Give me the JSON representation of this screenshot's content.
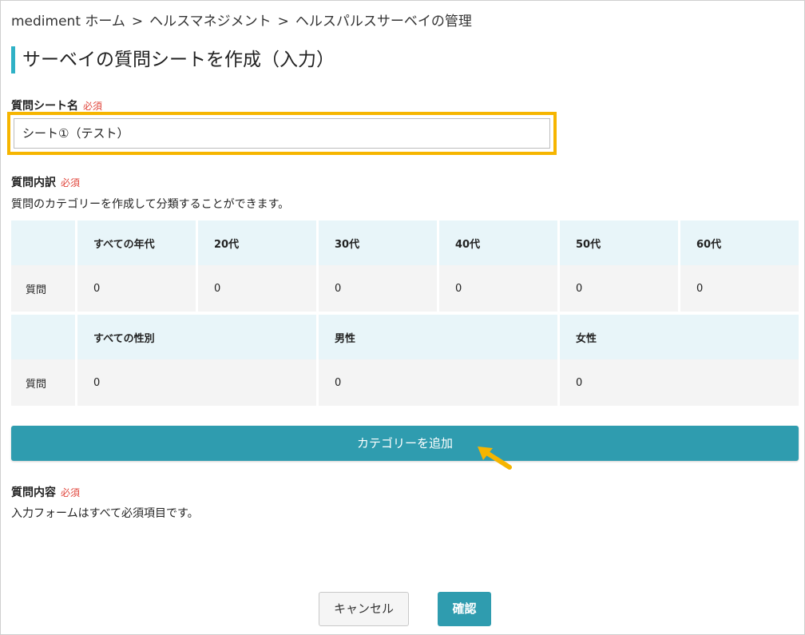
{
  "breadcrumb": {
    "items": [
      "mediment ホーム",
      "ヘルスマネジメント",
      "ヘルスパルスサーベイの管理"
    ],
    "separator": ">"
  },
  "page": {
    "title": "サーベイの質問シートを作成（入力）"
  },
  "sheet_name": {
    "label": "質問シート名",
    "required": "必須",
    "value": "シート①（テスト）"
  },
  "breakdown": {
    "label": "質問内訳",
    "required": "必須",
    "helper": "質問のカテゴリーを作成して分類することができます。",
    "age": {
      "headers": [
        "すべての年代",
        "20代",
        "30代",
        "40代",
        "50代",
        "60代"
      ],
      "row_label": "質問",
      "values": [
        "0",
        "0",
        "0",
        "0",
        "0",
        "0"
      ]
    },
    "gender": {
      "headers": [
        "すべての性別",
        "男性",
        "女性"
      ],
      "row_label": "質問",
      "values": [
        "0",
        "0",
        "0"
      ]
    }
  },
  "add_category_button": {
    "label": "カテゴリーを追加"
  },
  "content": {
    "label": "質問内容",
    "required": "必須",
    "note": "入力フォームはすべて必須項目です。"
  },
  "actions": {
    "cancel": "キャンセル",
    "confirm": "確認"
  },
  "colors": {
    "accent": "#2f9caf",
    "title_bar": "#2fb1c6",
    "highlight": "#f6b500",
    "required": "#e0453b",
    "header_bg": "#e8f5f9"
  }
}
